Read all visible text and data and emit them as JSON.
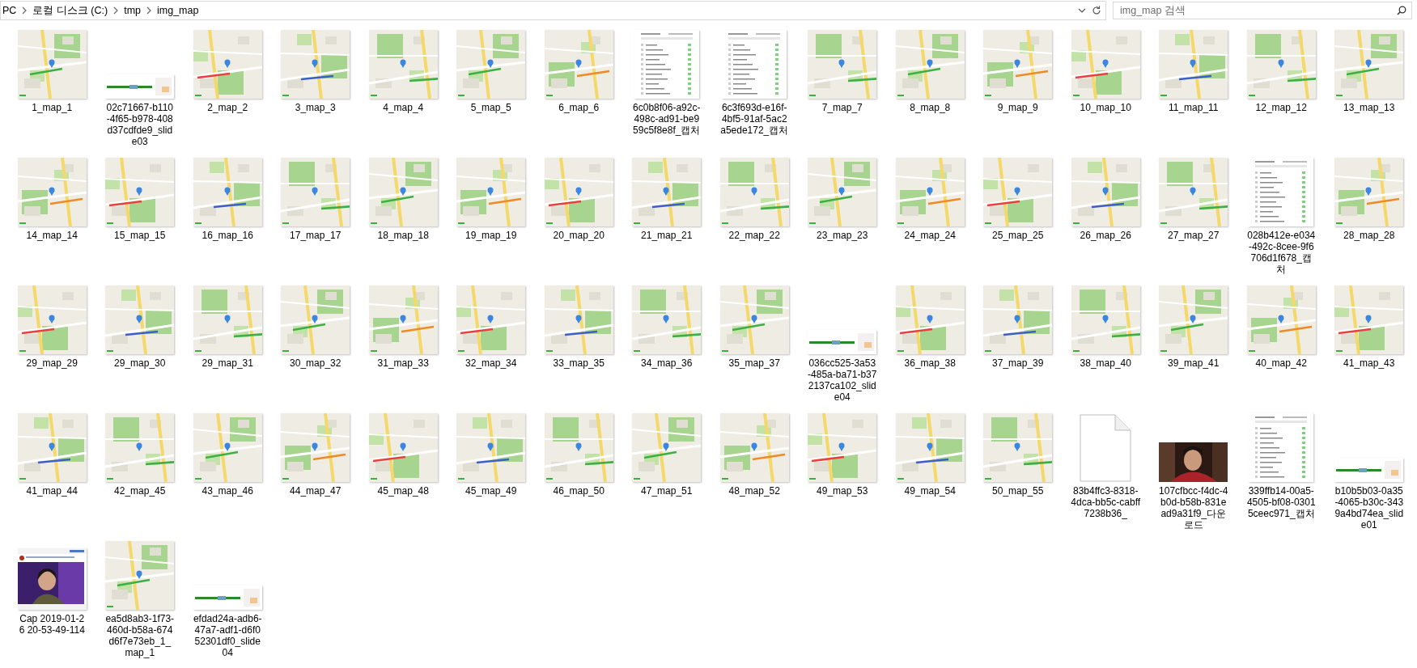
{
  "address_bar": {
    "path": [
      {
        "label": "PC"
      },
      {
        "label": "로컬 디스크 (C:)"
      },
      {
        "label": "tmp"
      },
      {
        "label": "img_map"
      }
    ]
  },
  "search": {
    "placeholder": "img_map 검색"
  },
  "files": [
    {
      "name": "1_map_1",
      "kind": "map"
    },
    {
      "name": "02c71667-b110-4f65-b978-408d37cdfde9_slide03",
      "kind": "slide"
    },
    {
      "name": "2_map_2",
      "kind": "map"
    },
    {
      "name": "3_map_3",
      "kind": "map"
    },
    {
      "name": "4_map_4",
      "kind": "map"
    },
    {
      "name": "5_map_5",
      "kind": "map"
    },
    {
      "name": "6_map_6",
      "kind": "map"
    },
    {
      "name": "6c0b8f06-a92c-498c-ad91-be959c5f8e8f_캡처",
      "kind": "capture"
    },
    {
      "name": "6c3f693d-e16f-4bf5-91af-5ac2a5ede172_캡처",
      "kind": "capture"
    },
    {
      "name": "7_map_7",
      "kind": "map"
    },
    {
      "name": "8_map_8",
      "kind": "map"
    },
    {
      "name": "9_map_9",
      "kind": "map"
    },
    {
      "name": "10_map_10",
      "kind": "map"
    },
    {
      "name": "11_map_11",
      "kind": "map"
    },
    {
      "name": "12_map_12",
      "kind": "map"
    },
    {
      "name": "13_map_13",
      "kind": "map"
    },
    {
      "name": "14_map_14",
      "kind": "map"
    },
    {
      "name": "15_map_15",
      "kind": "map"
    },
    {
      "name": "16_map_16",
      "kind": "map"
    },
    {
      "name": "17_map_17",
      "kind": "map"
    },
    {
      "name": "18_map_18",
      "kind": "map"
    },
    {
      "name": "19_map_19",
      "kind": "map"
    },
    {
      "name": "20_map_20",
      "kind": "map"
    },
    {
      "name": "21_map_21",
      "kind": "map"
    },
    {
      "name": "22_map_22",
      "kind": "map"
    },
    {
      "name": "23_map_23",
      "kind": "map"
    },
    {
      "name": "24_map_24",
      "kind": "map"
    },
    {
      "name": "25_map_25",
      "kind": "map"
    },
    {
      "name": "26_map_26",
      "kind": "map"
    },
    {
      "name": "27_map_27",
      "kind": "map"
    },
    {
      "name": "028b412e-e034-492c-8cee-9f6706d1f678_캡처",
      "kind": "capture"
    },
    {
      "name": "28_map_28",
      "kind": "map"
    },
    {
      "name": "29_map_29",
      "kind": "map"
    },
    {
      "name": "29_map_30",
      "kind": "map"
    },
    {
      "name": "29_map_31",
      "kind": "map"
    },
    {
      "name": "30_map_32",
      "kind": "map"
    },
    {
      "name": "31_map_33",
      "kind": "map"
    },
    {
      "name": "32_map_34",
      "kind": "map"
    },
    {
      "name": "33_map_35",
      "kind": "map"
    },
    {
      "name": "34_map_36",
      "kind": "map"
    },
    {
      "name": "35_map_37",
      "kind": "map"
    },
    {
      "name": "036cc525-3a53-485a-ba71-b372137ca102_slide04",
      "kind": "slide"
    },
    {
      "name": "36_map_38",
      "kind": "map"
    },
    {
      "name": "37_map_39",
      "kind": "map"
    },
    {
      "name": "38_map_40",
      "kind": "map"
    },
    {
      "name": "39_map_41",
      "kind": "map"
    },
    {
      "name": "40_map_42",
      "kind": "map"
    },
    {
      "name": "41_map_43",
      "kind": "map"
    },
    {
      "name": "41_map_44",
      "kind": "map"
    },
    {
      "name": "42_map_45",
      "kind": "map"
    },
    {
      "name": "43_map_46",
      "kind": "map"
    },
    {
      "name": "44_map_47",
      "kind": "map"
    },
    {
      "name": "45_map_48",
      "kind": "map"
    },
    {
      "name": "45_map_49",
      "kind": "map"
    },
    {
      "name": "46_map_50",
      "kind": "map"
    },
    {
      "name": "47_map_51",
      "kind": "map"
    },
    {
      "name": "48_map_52",
      "kind": "map"
    },
    {
      "name": "49_map_53",
      "kind": "map"
    },
    {
      "name": "49_map_54",
      "kind": "map"
    },
    {
      "name": "50_map_55",
      "kind": "map"
    },
    {
      "name": "83b4ffc3-8318-4dca-bb5c-cabff7238b36_",
      "kind": "file"
    },
    {
      "name": "107cfbcc-f4dc-4b0d-b58b-831ead9a31f9_다운로드"
    },
    {
      "name": "339ffb14-00a5-4505-bf08-03015ceec971_캡처",
      "kind": "capture"
    },
    {
      "name": "b10b5b03-0a35-4065-b30c-3439a4bd74ea_slide01",
      "kind": "slide"
    },
    {
      "name": "Cap 2019-01-26 20-53-49-114",
      "kind": "screen"
    },
    {
      "name": "ea5d8ab3-1f73-460d-b58a-674d6f7e73eb_1_map_1",
      "kind": "map"
    },
    {
      "name": "efdad24a-adb6-47a7-adf1-d6f052301df0_slide04",
      "kind": "slide"
    }
  ]
}
